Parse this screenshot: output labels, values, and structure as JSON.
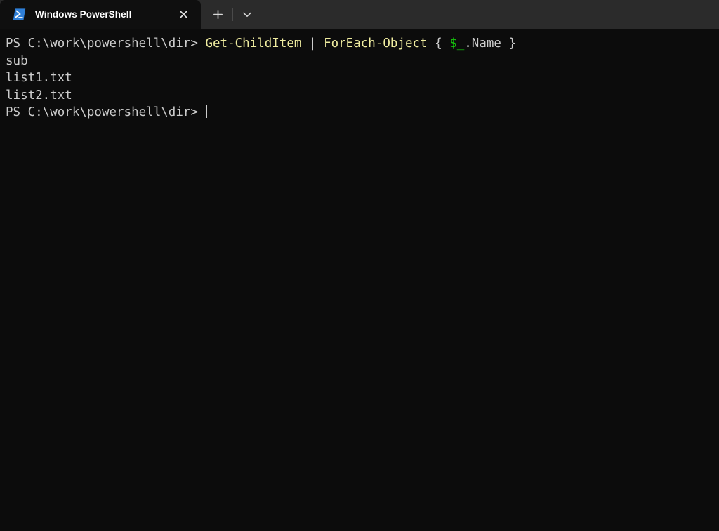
{
  "window": {
    "titlebar_color": "#2b2b2b",
    "terminal_bg": "#0c0c0c"
  },
  "tab": {
    "title": "Windows PowerShell",
    "icon_name": "powershell-icon",
    "close_label": "✕",
    "new_tab_label": "+",
    "dropdown_label": "⌄"
  },
  "terminal": {
    "colors": {
      "default_text": "#cccccc",
      "cmdlet": "#f0eda0",
      "variable": "#16c60c"
    },
    "lines": [
      {
        "id": "command-line",
        "segments": [
          {
            "text": "PS C:\\work\\powershell\\dir> ",
            "color": "default"
          },
          {
            "text": "Get-ChildItem",
            "color": "cmdlet"
          },
          {
            "text": " | ",
            "color": "default"
          },
          {
            "text": "ForEach-Object",
            "color": "cmdlet"
          },
          {
            "text": " { ",
            "color": "default"
          },
          {
            "text": "$_",
            "color": "variable"
          },
          {
            "text": ".Name }",
            "color": "default"
          }
        ]
      },
      {
        "id": "output-line-1",
        "segments": [
          {
            "text": "sub",
            "color": "default"
          }
        ]
      },
      {
        "id": "output-line-2",
        "segments": [
          {
            "text": "list1.txt",
            "color": "default"
          }
        ]
      },
      {
        "id": "output-line-3",
        "segments": [
          {
            "text": "list2.txt",
            "color": "default"
          }
        ]
      },
      {
        "id": "prompt-line",
        "segments": [
          {
            "text": "PS C:\\work\\powershell\\dir> ",
            "color": "default"
          }
        ],
        "cursor": true
      }
    ]
  }
}
